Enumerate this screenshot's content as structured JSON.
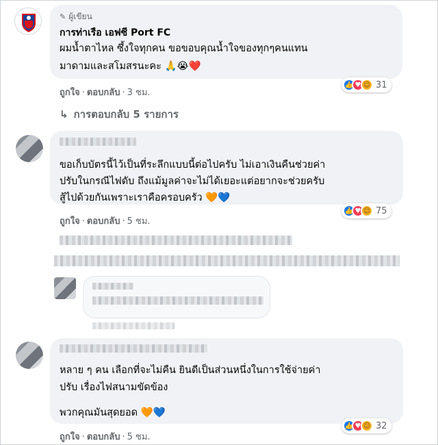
{
  "colors": {
    "bubble": "#f0f2f5",
    "link_blue": "#1877f2",
    "meta_gray": "#65676b",
    "author_badge": "#65676b"
  },
  "comment1": {
    "badge_icon": "pencil-icon",
    "badge_label": "ผู้เขียน",
    "author": "การท่าเรือ เอฟซี Port FC",
    "lines": [
      "ผมน้ำตาไหล ซึ้งใจทุกคน ขอขอบคุณน้ำใจของทุกๆคนแทน",
      "มาดามและสโมสรนะคะ 🙏😭❤️"
    ],
    "like": "ถูกใจ",
    "reply": "ตอบกลับ",
    "time": "3 ชม.",
    "reaction_count": "31",
    "replies_link": "การตอบกลับ 5 รายการ"
  },
  "comment2": {
    "lines": [
      "ขอเก็บบัตรนี้ไว้เป็นที่ระลึกแบบนี้ต่อไปครับ ไม่เอาเงินคืนช่วยค่า",
      "ปรับในกรณีไฟดับ ถึงแม้มูลค่าจะไม่ได้เยอะแต่อยากจะช่วยครับ",
      "สู้ไปด้วยกันเพราะเราคือครอบครัว 🧡💙"
    ],
    "like": "ถูกใจ",
    "reply": "ตอบกลับ",
    "time": "5 ชม.",
    "reaction_count": "75"
  },
  "comment3": {
    "lines": [
      "หลาย ๆ คน เลือกที่จะไม่คืน ยินดีเป็นส่วนหนึ่งในการใช้จ่ายค่า",
      "ปรับ เรื่องไฟสนามขัดข้อง"
    ],
    "line3": "พวกคุณมันสุดยอด 🧡💙",
    "like": "ถูกใจ",
    "reply": "ตอบกลับ",
    "time": "5 ชม.",
    "reaction_count": "32"
  }
}
